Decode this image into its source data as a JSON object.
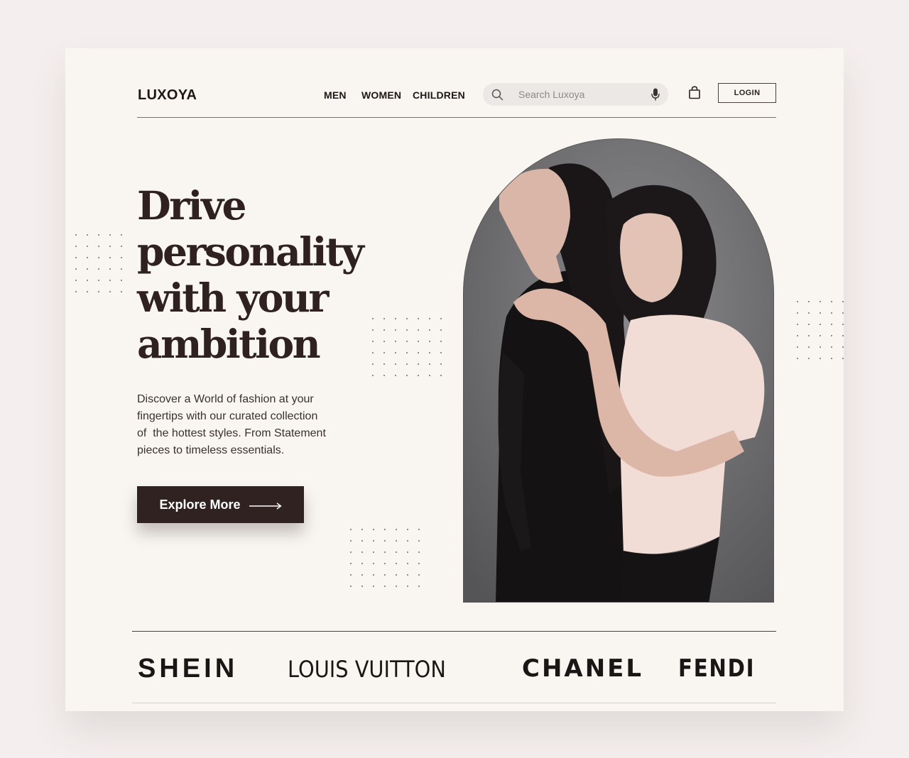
{
  "header": {
    "logo": "LUXOYA",
    "nav": [
      {
        "label": "MEN"
      },
      {
        "label": "WOMEN"
      },
      {
        "label": "CHILDREN"
      }
    ],
    "search": {
      "placeholder": "Search Luxoya",
      "value": ""
    },
    "login_label": "LOGIN"
  },
  "hero": {
    "title_lines": [
      "Drive",
      "personality",
      "with your",
      "ambition"
    ],
    "description_lines": [
      "Discover a World of fashion at your",
      "fingertips with our curated collection",
      "of  the hottest styles. From Statement",
      "pieces to timeless essentials."
    ],
    "cta_label": "Explore More"
  },
  "brands": [
    "SHEIN",
    "LOUIS VUITTON",
    "CHANEL",
    "FENDI"
  ],
  "icons": {
    "search": "search-icon",
    "mic": "microphone-icon",
    "bag": "shopping-bag-icon",
    "arrow": "arrow-right-icon"
  },
  "colors": {
    "page_bg": "#f4efee",
    "card_bg": "#f9f6f1",
    "text_dark": "#2e2120",
    "cta_bg": "#302221"
  }
}
